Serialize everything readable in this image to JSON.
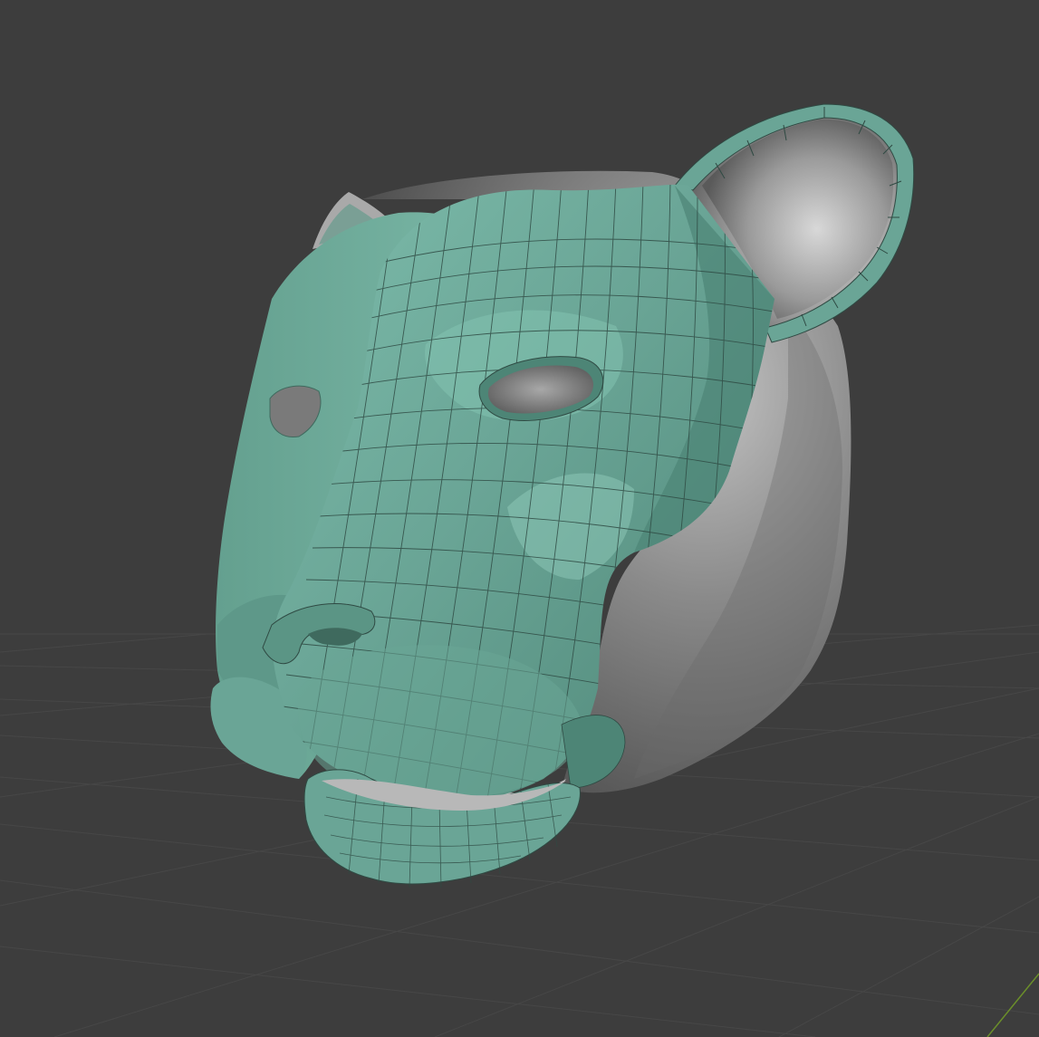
{
  "app": {
    "view": "3D Viewport",
    "mode": "retopology-overlay"
  },
  "scene": {
    "object": "panther-head-sculpt",
    "overlay_object": "retopology-mesh"
  },
  "colors": {
    "viewport_background": "#3d3d3d",
    "grid_line": "#4a4a4a",
    "grid_line_dark": "#363636",
    "x_axis": "#6b8f2a",
    "sculpt_base": "#8e8e8e",
    "sculpt_shadow": "#575757",
    "sculpt_highlight": "#cfcfcf",
    "retopo_base": "#6aa596",
    "retopo_light": "#9bcfc0",
    "retopo_dark": "#477a6c",
    "wire": "#2f4a43"
  }
}
